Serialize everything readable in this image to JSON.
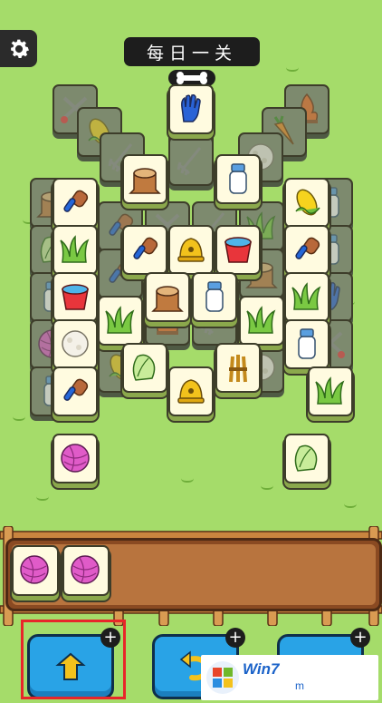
{
  "header": {
    "title": "每日一关",
    "settings_icon": "gear-icon"
  },
  "board": {
    "tiles_front": [
      "glove",
      "haystack",
      "milk-bottle",
      "hairbrush",
      "corn",
      "grass",
      "hairbrush",
      "bell",
      "bucket",
      "hairbrush",
      "bucket",
      "tree-stump",
      "milk-bottle",
      "grass",
      "grass",
      "grass",
      "yarn-ball",
      "cabbage",
      "wheat-bundle",
      "milk-bottle",
      "hairbrush",
      "bell",
      "grass",
      "tree-stump",
      "hairbrush",
      "yarn-ball",
      "cabbage"
    ]
  },
  "tray": {
    "items": [
      "yarn-ball",
      "yarn-ball"
    ]
  },
  "buttons": [
    {
      "name": "move-out-button",
      "icon": "box-arrow-up-icon"
    },
    {
      "name": "undo-button",
      "icon": "undo-arrow-icon"
    },
    {
      "name": "shuffle-button",
      "icon": "shuffle-icon"
    }
  ],
  "watermark": {
    "text": "Win7",
    "sub": "m"
  },
  "colors": {
    "background": "#a5dc6a",
    "tile_face": "#fffbe0",
    "button": "#29a3e6",
    "highlight": "#e8262a"
  }
}
